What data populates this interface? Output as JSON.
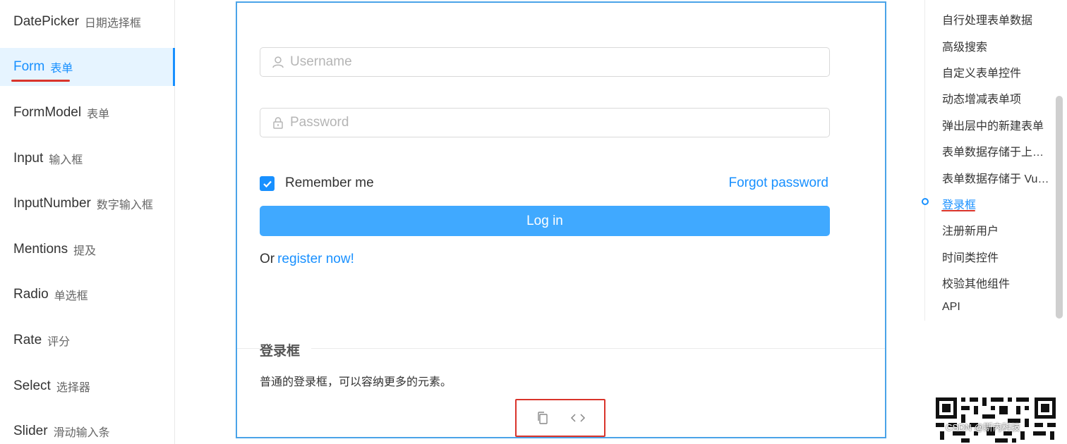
{
  "sidebar": {
    "items": [
      {
        "en": "DatePicker",
        "zh": "日期选择框"
      },
      {
        "en": "Form",
        "zh": "表单"
      },
      {
        "en": "FormModel",
        "zh": "表单"
      },
      {
        "en": "Input",
        "zh": "输入框"
      },
      {
        "en": "InputNumber",
        "zh": "数字输入框"
      },
      {
        "en": "Mentions",
        "zh": "提及"
      },
      {
        "en": "Radio",
        "zh": "单选框"
      },
      {
        "en": "Rate",
        "zh": "评分"
      },
      {
        "en": "Select",
        "zh": "选择器"
      },
      {
        "en": "Slider",
        "zh": "滑动输入条"
      }
    ],
    "active_index": 1
  },
  "demo": {
    "username_placeholder": "Username",
    "password_placeholder": "Password",
    "remember_label": "Remember me",
    "remember_checked": true,
    "forgot_link": "Forgot password",
    "login_button": "Log in",
    "or_text": "Or",
    "register_link": "register now!",
    "title": "登录框",
    "description": "普通的登录框，可以容纳更多的元素。"
  },
  "anchor": {
    "items": [
      "自行处理表单数据",
      "高级搜索",
      "自定义表单控件",
      "动态增减表单项",
      "弹出层中的新建表单",
      "表单数据存储于上层组件",
      "表单数据存储于 Vuex 中",
      "登录框",
      "注册新用户",
      "时间类控件",
      "校验其他组件",
      "API"
    ],
    "active_index": 7
  },
  "watermark": "CSDN @斯内科技",
  "colors": {
    "primary": "#1890ff",
    "button": "#40a9ff",
    "highlight_red": "#d9342b",
    "card_border": "#4aa3e8"
  }
}
